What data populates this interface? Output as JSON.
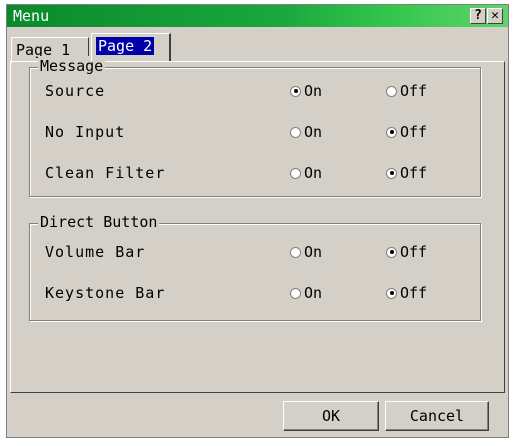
{
  "window": {
    "title": "Menu",
    "help_button": "?",
    "close_button": "✕"
  },
  "tabs": [
    {
      "label": "Page 1",
      "selected": false
    },
    {
      "label": "Page 2",
      "selected": true
    }
  ],
  "groups": [
    {
      "title": "Message",
      "rows": [
        {
          "label": "Source",
          "on_label": "On",
          "off_label": "Off",
          "value": "On"
        },
        {
          "label": "No Input",
          "on_label": "On",
          "off_label": "Off",
          "value": "Off"
        },
        {
          "label": "Clean Filter",
          "on_label": "On",
          "off_label": "Off",
          "value": "Off"
        }
      ]
    },
    {
      "title": "Direct Button",
      "rows": [
        {
          "label": "Volume Bar",
          "on_label": "On",
          "off_label": "Off",
          "value": "Off"
        },
        {
          "label": "Keystone Bar",
          "on_label": "On",
          "off_label": "Off",
          "value": "Off"
        }
      ]
    }
  ],
  "buttons": {
    "ok": "OK",
    "cancel": "Cancel"
  },
  "colors": {
    "title_bar": "#0b8a2c",
    "selected_tab": "#0000a8",
    "face": "#d4d0c8"
  }
}
